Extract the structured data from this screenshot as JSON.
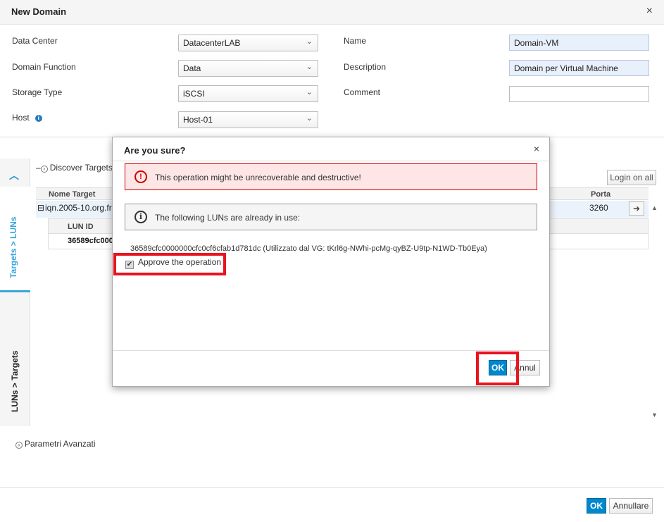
{
  "dialog": {
    "title": "New Domain",
    "close": "×"
  },
  "form": {
    "data_center": {
      "label": "Data Center",
      "value": "DatacenterLAB"
    },
    "domain_function": {
      "label": "Domain Function",
      "value": "Data"
    },
    "storage_type": {
      "label": "Storage Type",
      "value": "iSCSI"
    },
    "host": {
      "label": "Host",
      "value": "Host-01"
    },
    "name": {
      "label": "Name",
      "value": "Domain-VM"
    },
    "description": {
      "label": "Description",
      "value": "Domain per Virtual Machine"
    },
    "comment": {
      "label": "Comment",
      "value": ""
    }
  },
  "tabs": {
    "targets_luns": "Targets > LUNs",
    "luns_targets": "LUNs > Targets"
  },
  "targets": {
    "discover": "Discover Targets",
    "login_all": "Login on all",
    "col_target": "Nome Target",
    "col_port": "Porta",
    "row_target": "iqn.2005-10.org.fre",
    "row_port": "3260",
    "lun_col": "LUN ID",
    "lun_value": "36589cfc000"
  },
  "advanced": "Parametri Avanzati",
  "footer": {
    "ok": "OK",
    "cancel": "Annullare"
  },
  "confirm": {
    "title": "Are you sure?",
    "close": "×",
    "danger": "This operation might be unrecoverable and destructive!",
    "info": "The following LUNs are already in use:",
    "lun_entry": "36589cfc0000000cfc0cf6cfab1d781dc (Utilizzato dal VG: tKrl6g-NWhi-pcMg-qyBZ-U9tp-N1WD-Tb0Eya)",
    "approve": "Approve the operation",
    "approved": true,
    "ok": "OK",
    "cancel": "Annul"
  },
  "colors": {
    "primary": "#0088ce",
    "danger": "#cc0000",
    "highlight": "#e8141e"
  }
}
